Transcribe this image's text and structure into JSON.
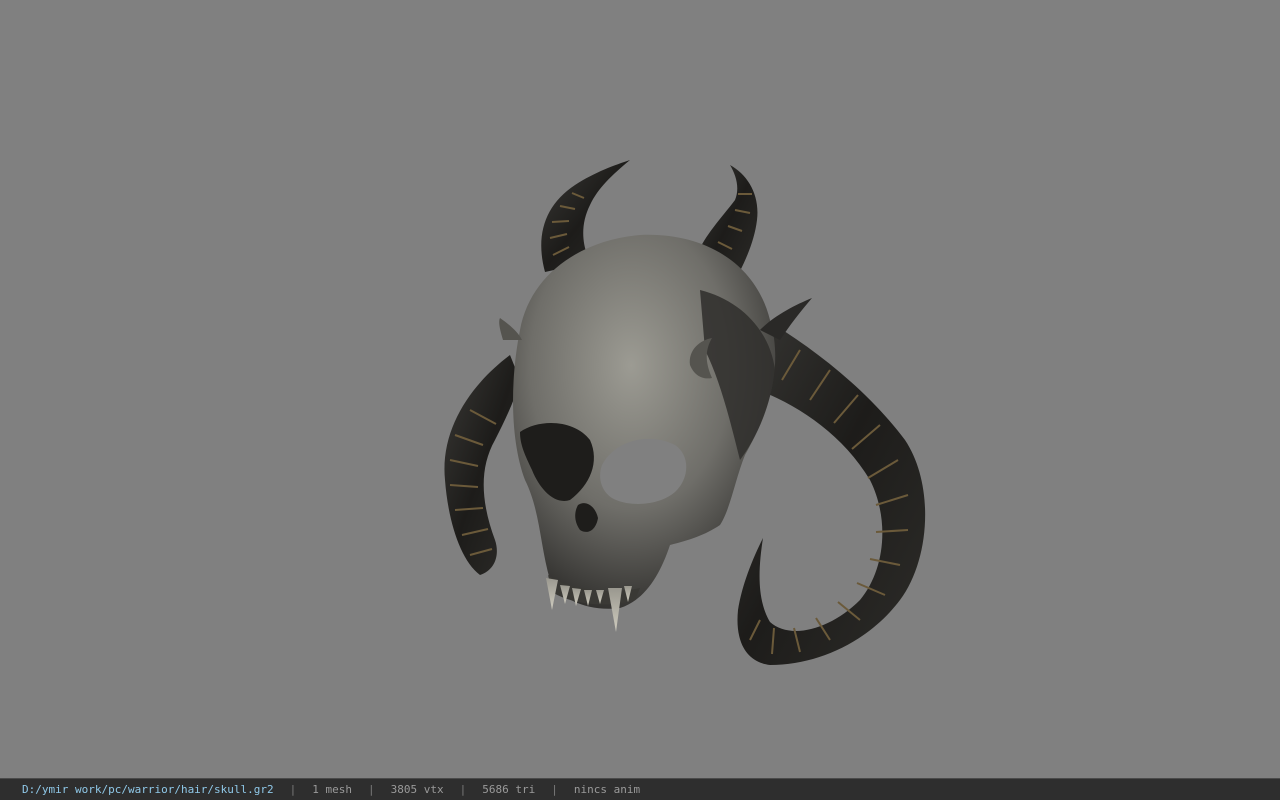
{
  "viewer": {
    "background_color": "#808080"
  },
  "model": {
    "icon": "demon-skull-model"
  },
  "status": {
    "file_path": "D:/ymir work/pc/warrior/hair/skull.gr2",
    "mesh_count": "1 mesh",
    "vertex_count": "3805 vtx",
    "triangle_count": "5686 tri",
    "animation": "nincs anim",
    "separator": "|"
  }
}
